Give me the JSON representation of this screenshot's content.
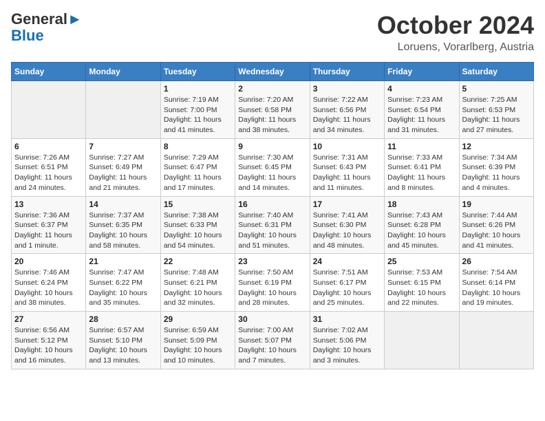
{
  "header": {
    "logo_line1": "General",
    "logo_line2": "Blue",
    "month": "October 2024",
    "location": "Loruens, Vorarlberg, Austria"
  },
  "days_of_week": [
    "Sunday",
    "Monday",
    "Tuesday",
    "Wednesday",
    "Thursday",
    "Friday",
    "Saturday"
  ],
  "weeks": [
    [
      {
        "day": "",
        "info": ""
      },
      {
        "day": "",
        "info": ""
      },
      {
        "day": "1",
        "info": "Sunrise: 7:19 AM\nSunset: 7:00 PM\nDaylight: 11 hours and 41 minutes."
      },
      {
        "day": "2",
        "info": "Sunrise: 7:20 AM\nSunset: 6:58 PM\nDaylight: 11 hours and 38 minutes."
      },
      {
        "day": "3",
        "info": "Sunrise: 7:22 AM\nSunset: 6:56 PM\nDaylight: 11 hours and 34 minutes."
      },
      {
        "day": "4",
        "info": "Sunrise: 7:23 AM\nSunset: 6:54 PM\nDaylight: 11 hours and 31 minutes."
      },
      {
        "day": "5",
        "info": "Sunrise: 7:25 AM\nSunset: 6:53 PM\nDaylight: 11 hours and 27 minutes."
      }
    ],
    [
      {
        "day": "6",
        "info": "Sunrise: 7:26 AM\nSunset: 6:51 PM\nDaylight: 11 hours and 24 minutes."
      },
      {
        "day": "7",
        "info": "Sunrise: 7:27 AM\nSunset: 6:49 PM\nDaylight: 11 hours and 21 minutes."
      },
      {
        "day": "8",
        "info": "Sunrise: 7:29 AM\nSunset: 6:47 PM\nDaylight: 11 hours and 17 minutes."
      },
      {
        "day": "9",
        "info": "Sunrise: 7:30 AM\nSunset: 6:45 PM\nDaylight: 11 hours and 14 minutes."
      },
      {
        "day": "10",
        "info": "Sunrise: 7:31 AM\nSunset: 6:43 PM\nDaylight: 11 hours and 11 minutes."
      },
      {
        "day": "11",
        "info": "Sunrise: 7:33 AM\nSunset: 6:41 PM\nDaylight: 11 hours and 8 minutes."
      },
      {
        "day": "12",
        "info": "Sunrise: 7:34 AM\nSunset: 6:39 PM\nDaylight: 11 hours and 4 minutes."
      }
    ],
    [
      {
        "day": "13",
        "info": "Sunrise: 7:36 AM\nSunset: 6:37 PM\nDaylight: 11 hours and 1 minute."
      },
      {
        "day": "14",
        "info": "Sunrise: 7:37 AM\nSunset: 6:35 PM\nDaylight: 10 hours and 58 minutes."
      },
      {
        "day": "15",
        "info": "Sunrise: 7:38 AM\nSunset: 6:33 PM\nDaylight: 10 hours and 54 minutes."
      },
      {
        "day": "16",
        "info": "Sunrise: 7:40 AM\nSunset: 6:31 PM\nDaylight: 10 hours and 51 minutes."
      },
      {
        "day": "17",
        "info": "Sunrise: 7:41 AM\nSunset: 6:30 PM\nDaylight: 10 hours and 48 minutes."
      },
      {
        "day": "18",
        "info": "Sunrise: 7:43 AM\nSunset: 6:28 PM\nDaylight: 10 hours and 45 minutes."
      },
      {
        "day": "19",
        "info": "Sunrise: 7:44 AM\nSunset: 6:26 PM\nDaylight: 10 hours and 41 minutes."
      }
    ],
    [
      {
        "day": "20",
        "info": "Sunrise: 7:46 AM\nSunset: 6:24 PM\nDaylight: 10 hours and 38 minutes."
      },
      {
        "day": "21",
        "info": "Sunrise: 7:47 AM\nSunset: 6:22 PM\nDaylight: 10 hours and 35 minutes."
      },
      {
        "day": "22",
        "info": "Sunrise: 7:48 AM\nSunset: 6:21 PM\nDaylight: 10 hours and 32 minutes."
      },
      {
        "day": "23",
        "info": "Sunrise: 7:50 AM\nSunset: 6:19 PM\nDaylight: 10 hours and 28 minutes."
      },
      {
        "day": "24",
        "info": "Sunrise: 7:51 AM\nSunset: 6:17 PM\nDaylight: 10 hours and 25 minutes."
      },
      {
        "day": "25",
        "info": "Sunrise: 7:53 AM\nSunset: 6:15 PM\nDaylight: 10 hours and 22 minutes."
      },
      {
        "day": "26",
        "info": "Sunrise: 7:54 AM\nSunset: 6:14 PM\nDaylight: 10 hours and 19 minutes."
      }
    ],
    [
      {
        "day": "27",
        "info": "Sunrise: 6:56 AM\nSunset: 5:12 PM\nDaylight: 10 hours and 16 minutes."
      },
      {
        "day": "28",
        "info": "Sunrise: 6:57 AM\nSunset: 5:10 PM\nDaylight: 10 hours and 13 minutes."
      },
      {
        "day": "29",
        "info": "Sunrise: 6:59 AM\nSunset: 5:09 PM\nDaylight: 10 hours and 10 minutes."
      },
      {
        "day": "30",
        "info": "Sunrise: 7:00 AM\nSunset: 5:07 PM\nDaylight: 10 hours and 7 minutes."
      },
      {
        "day": "31",
        "info": "Sunrise: 7:02 AM\nSunset: 5:06 PM\nDaylight: 10 hours and 3 minutes."
      },
      {
        "day": "",
        "info": ""
      },
      {
        "day": "",
        "info": ""
      }
    ]
  ]
}
